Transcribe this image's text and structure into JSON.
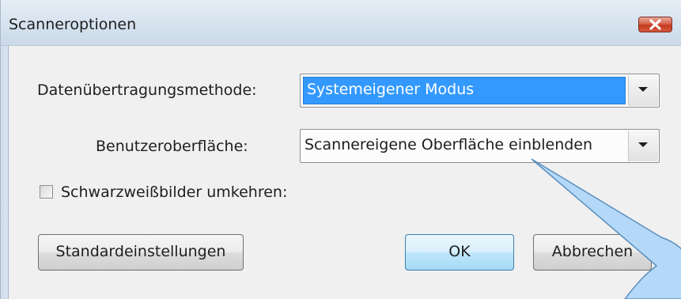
{
  "window": {
    "title": "Scanneroptionen",
    "close_icon": "close-icon"
  },
  "form": {
    "transfer_method_label": "Datenübertragungsmethode:",
    "transfer_method_value": "Systemeigener Modus",
    "ui_label": "Benutzeroberfläche:",
    "ui_value": "Scannereigene Oberfläche einblenden",
    "invert_checkbox_label": "Schwarzweißbilder umkehren:",
    "invert_checked": false
  },
  "buttons": {
    "defaults_label": "Standardeinstellungen",
    "ok_label": "OK",
    "cancel_label": "Abbrechen"
  },
  "colors": {
    "selection": "#3399ff",
    "callout_fill": "#b4d9f8",
    "callout_stroke": "#5b8fbd",
    "close_button": "#c4391f"
  }
}
